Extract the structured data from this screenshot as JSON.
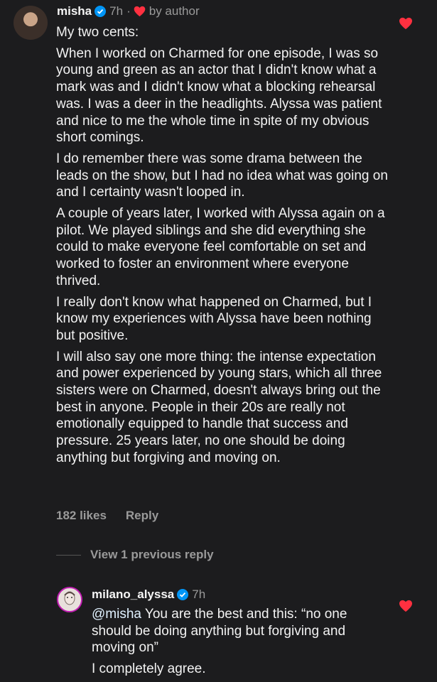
{
  "comment": {
    "username": "misha",
    "time": "7h",
    "separator": "·",
    "liked_by": "by author",
    "paragraphs": [
      "My two cents:",
      "When I worked on Charmed for one episode, I was so young and green as an actor that I didn't know what a mark was and I didn't know what a blocking rehearsal was. I was a deer in the headlights. Alyssa was patient and nice to me the whole time in spite of my obvious short comings.",
      "I do remember there was some drama between the leads on the show, but I had no idea what was going on and I certainty wasn't looped in.",
      "A couple of years later, I worked with Alyssa again on a pilot. We played siblings and she did everything she could to make everyone feel comfortable on set and worked to foster an environment where everyone thrived.",
      "I really don't know what happened on Charmed, but I know my experiences with Alyssa have been nothing but positive.",
      "I will also say one more thing: the intense expectation and power experienced by young stars, which all three sisters were on Charmed, doesn't always bring out the best in anyone. People in their 20s are really not emotionally equipped to handle that success and pressure. 25 years later, no one should be doing anything but forgiving and moving on."
    ],
    "likes": "182 likes",
    "reply_label": "Reply"
  },
  "view_replies": "View 1 previous reply",
  "reply": {
    "username": "milano_alyssa",
    "time": "7h",
    "mention": "@misha",
    "text": " You are the best and this: “no one should be doing anything but forgiving and moving on”",
    "text2": "I completely agree."
  },
  "colors": {
    "heart": "#ff3040",
    "verified": "#0095f6",
    "muted": "#9a9a9a"
  }
}
